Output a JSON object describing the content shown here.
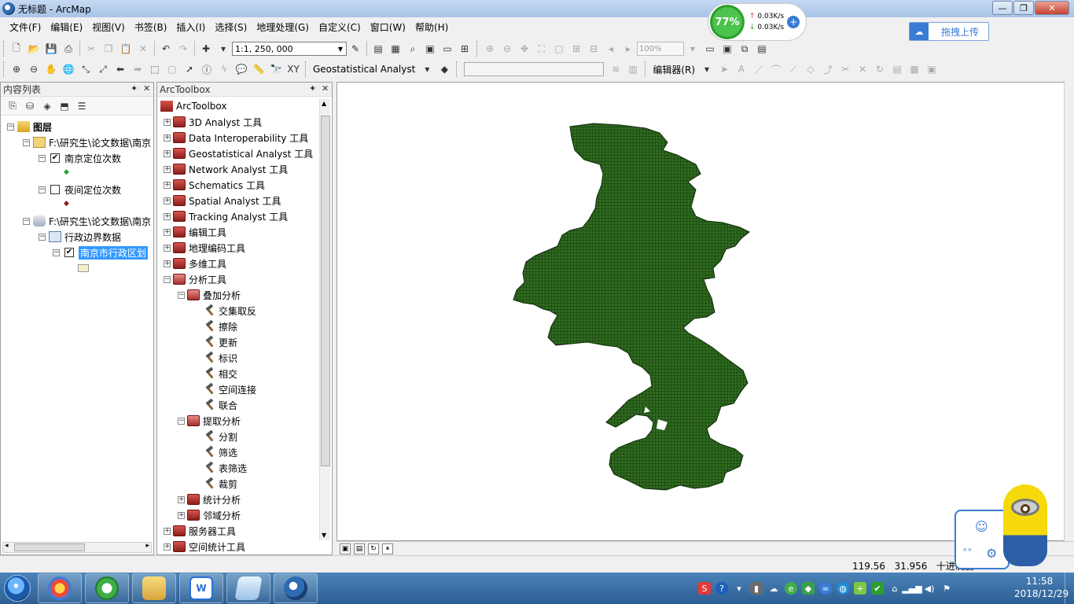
{
  "window": {
    "title": "无标题 - ArcMap",
    "min": "—",
    "max": "❐",
    "close": "✕"
  },
  "menu": [
    "文件(F)",
    "编辑(E)",
    "视图(V)",
    "书签(B)",
    "插入(I)",
    "选择(S)",
    "地理处理(G)",
    "自定义(C)",
    "窗口(W)",
    "帮助(H)"
  ],
  "net_widget": {
    "percent": "77%",
    "up": "0.03K/s",
    "down": "0.03K/s"
  },
  "upload_button": {
    "label": "拖拽上传"
  },
  "toolbar": {
    "scale": "1:1, 250, 000",
    "zoom": "100%",
    "geostat": "Geostatistical Analyst",
    "editor": "编辑器(R)"
  },
  "toc": {
    "title": "内容列表",
    "rows": [
      {
        "label": "图层"
      },
      {
        "label": "F:\\研究生\\论文数据\\南京"
      },
      {
        "label": "南京定位次数"
      },
      {
        "label": "夜间定位次数"
      },
      {
        "label": "F:\\研究生\\论文数据\\南京"
      },
      {
        "label": "行政边界数据"
      },
      {
        "label": "南京市行政区划"
      }
    ]
  },
  "arctoolbox": {
    "title": "ArcToolbox",
    "root": "ArcToolbox",
    "toolboxes": [
      "3D Analyst 工具",
      "Data Interoperability 工具",
      "Geostatistical Analyst 工具",
      "Network Analyst 工具",
      "Schematics 工具",
      "Spatial Analyst 工具",
      "Tracking Analyst 工具",
      "编辑工具",
      "地理编码工具",
      "多维工具",
      "分析工具"
    ],
    "overlay": {
      "label": "叠加分析",
      "tools": [
        "交集取反",
        "擦除",
        "更新",
        "标识",
        "相交",
        "空间连接",
        "联合"
      ]
    },
    "extract": {
      "label": "提取分析",
      "tools": [
        "分割",
        "筛选",
        "表筛选",
        "裁剪"
      ]
    },
    "more_toolsets": [
      "统计分析",
      "邻域分析"
    ],
    "tail_toolboxes": [
      "服务器工具",
      "空间统计工具"
    ]
  },
  "status": {
    "x": "119.56",
    "y": "31.956",
    "units": "十进制度"
  },
  "clock": {
    "time": "11:58",
    "date": "2018/12/29"
  },
  "colors": {
    "polygon_fill": "#2e6b1f",
    "polygon_stroke": "#0f2a0a",
    "selection": "#3399ff"
  }
}
